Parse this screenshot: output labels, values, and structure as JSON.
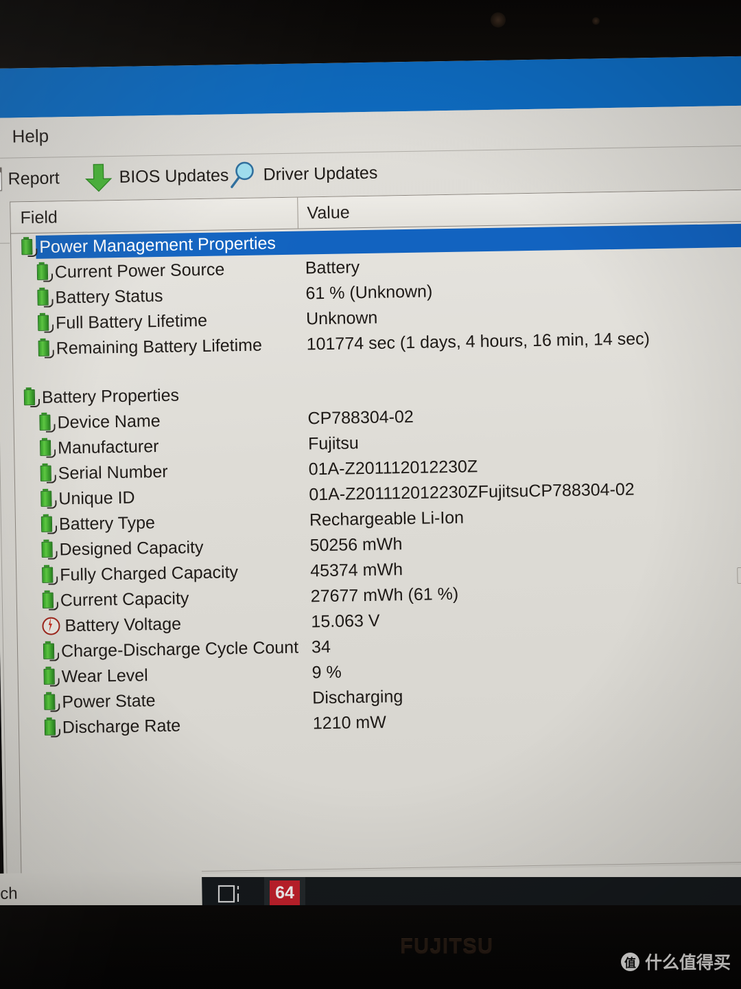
{
  "window": {
    "titlebar_color": "#0e6cc2",
    "menu": {
      "help_label": "Help"
    }
  },
  "toolbar": {
    "doc_icon": "document-icon",
    "report_label": "Report",
    "bios_icon": "green-down-arrow-icon",
    "bios_label": "BIOS Updates",
    "driver_icon": "magnifier-icon",
    "driver_label": "Driver Updates"
  },
  "table": {
    "columns": {
      "field": "Field",
      "value": "Value"
    },
    "rows": [
      {
        "label": "Power Management Properties",
        "value": "",
        "icon": "battery-icon",
        "indent": 0,
        "selected": true
      },
      {
        "label": "Current Power Source",
        "value": "Battery",
        "icon": "battery-icon",
        "indent": 1,
        "selected": false
      },
      {
        "label": "Battery Status",
        "value": "61 % (Unknown)",
        "icon": "battery-icon",
        "indent": 1,
        "selected": false
      },
      {
        "label": "Full Battery Lifetime",
        "value": "Unknown",
        "icon": "battery-icon",
        "indent": 1,
        "selected": false
      },
      {
        "label": "Remaining Battery Lifetime",
        "value": "101774 sec (1 days, 4 hours, 16 min, 14 sec)",
        "icon": "battery-icon",
        "indent": 1,
        "selected": false
      },
      {
        "label": "",
        "value": "",
        "icon": "none",
        "indent": 0,
        "selected": false
      },
      {
        "label": "Battery Properties",
        "value": "",
        "icon": "battery-icon",
        "indent": 0,
        "selected": false
      },
      {
        "label": "Device Name",
        "value": "CP788304-02",
        "icon": "battery-icon",
        "indent": 1,
        "selected": false
      },
      {
        "label": "Manufacturer",
        "value": "Fujitsu",
        "icon": "battery-icon",
        "indent": 1,
        "selected": false
      },
      {
        "label": "Serial Number",
        "value": "01A-Z201112012230Z",
        "icon": "battery-icon",
        "indent": 1,
        "selected": false
      },
      {
        "label": "Unique ID",
        "value": "01A-Z201112012230ZFujitsuCP788304-02",
        "icon": "battery-icon",
        "indent": 1,
        "selected": false
      },
      {
        "label": "Battery Type",
        "value": "Rechargeable Li-Ion",
        "icon": "battery-icon",
        "indent": 1,
        "selected": false
      },
      {
        "label": "Designed Capacity",
        "value": "50256 mWh",
        "icon": "battery-icon",
        "indent": 1,
        "selected": false
      },
      {
        "label": "Fully Charged Capacity",
        "value": "45374 mWh",
        "icon": "battery-icon",
        "indent": 1,
        "selected": false
      },
      {
        "label": "Current Capacity",
        "value": "27677 mWh  (61 %)",
        "icon": "battery-icon",
        "indent": 1,
        "selected": false
      },
      {
        "label": "Battery Voltage",
        "value": "15.063 V",
        "icon": "lightning-bolt-icon",
        "indent": 1,
        "selected": false
      },
      {
        "label": "Charge-Discharge Cycle Count",
        "value": "34",
        "icon": "battery-icon",
        "indent": 1,
        "selected": false
      },
      {
        "label": "Wear Level",
        "value": "9 %",
        "icon": "battery-icon",
        "indent": 1,
        "selected": false
      },
      {
        "label": "Power State",
        "value": "Discharging",
        "icon": "battery-icon",
        "indent": 1,
        "selected": false
      },
      {
        "label": "Discharge Rate",
        "value": "1210 mW",
        "icon": "battery-icon",
        "indent": 1,
        "selected": false
      }
    ],
    "selection_color": "#1263c0"
  },
  "taskbar": {
    "search_text": "ch",
    "taskview_icon": "task-view-icon",
    "app_label": "64",
    "app_color": "#c0202b",
    "active_indicator_color": "#2f79c0"
  },
  "device": {
    "brand_logo": "FUJITSU"
  },
  "watermark": {
    "badge": "值",
    "text": "什么值得买"
  }
}
